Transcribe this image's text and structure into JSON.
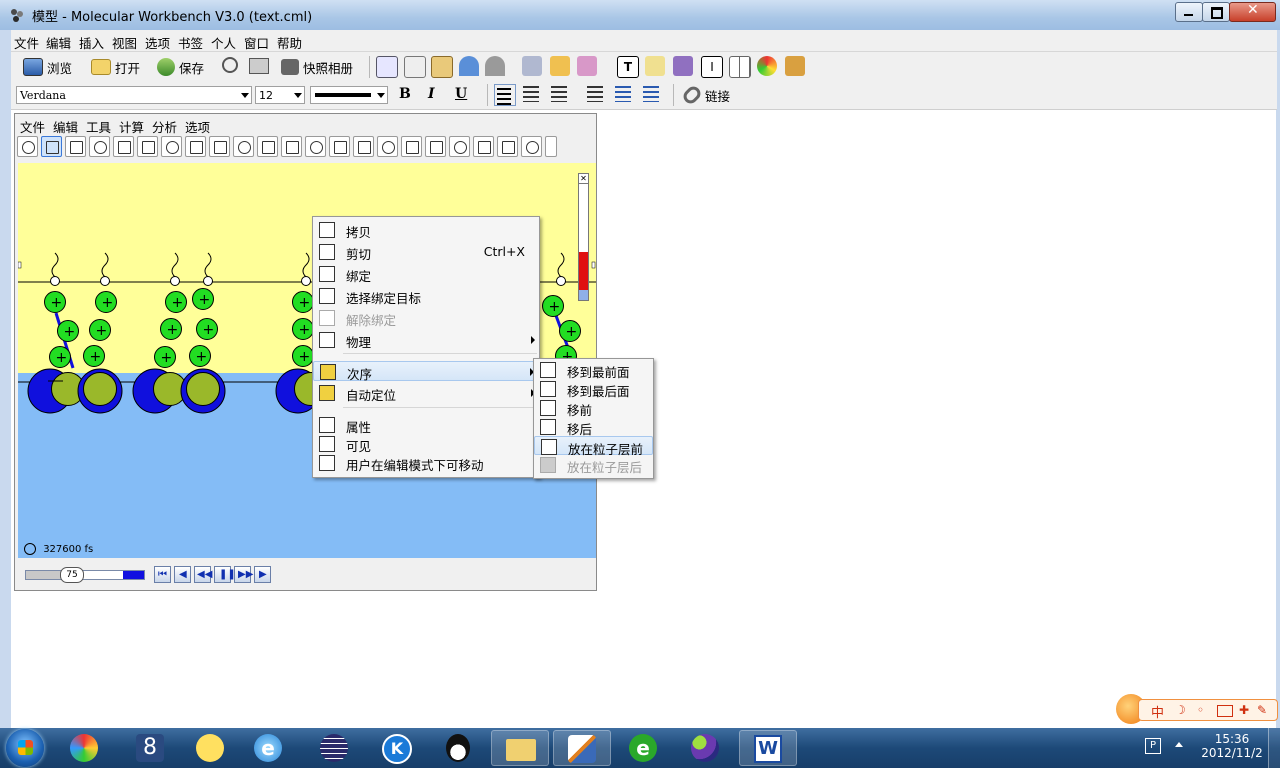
{
  "window": {
    "title": "模型 - Molecular Workbench V3.0 (text.cml)"
  },
  "menubar": [
    "文件",
    "编辑",
    "插入",
    "视图",
    "选项",
    "书签",
    "个人",
    "窗口",
    "帮助"
  ],
  "toolbar": {
    "browse": "浏览",
    "open": "打开",
    "save": "保存",
    "snapshot": "快照相册",
    "link": "链接"
  },
  "format": {
    "font": "Verdana",
    "size": "12",
    "bold": "B",
    "italic": "I",
    "underline": "U"
  },
  "model": {
    "menu": [
      "文件",
      "编辑",
      "工具",
      "计算",
      "分析",
      "选项"
    ],
    "time": "327600 fs",
    "speed": "75"
  },
  "context_menu": {
    "items": [
      {
        "label": "拷贝",
        "shortcut": ""
      },
      {
        "label": "剪切",
        "shortcut": "Ctrl+X"
      },
      {
        "label": "绑定",
        "shortcut": ""
      },
      {
        "label": "选择绑定目标",
        "shortcut": ""
      },
      {
        "label": "解除绑定",
        "shortcut": ""
      },
      {
        "label": "物理",
        "shortcut": ""
      },
      {
        "label": "次序",
        "shortcut": ""
      },
      {
        "label": "自动定位",
        "shortcut": ""
      },
      {
        "label": "属性",
        "shortcut": ""
      },
      {
        "label": "可见",
        "shortcut": ""
      },
      {
        "label": "用户在编辑模式下可移动",
        "shortcut": ""
      }
    ]
  },
  "submenu": {
    "items": [
      "移到最前面",
      "移到最后面",
      "移前",
      "移后",
      "放在粒子层前",
      "放在粒子层后"
    ]
  },
  "ime": {
    "mode": "中"
  },
  "clock": {
    "time": "15:36",
    "date": "2012/11/2"
  },
  "colors": {
    "canvas_top": "#ffff99",
    "canvas_bottom": "#84bcf6",
    "atom_green": "#22dd22",
    "atom_blue": "#1010dd",
    "atom_olive": "#9ab82a"
  }
}
